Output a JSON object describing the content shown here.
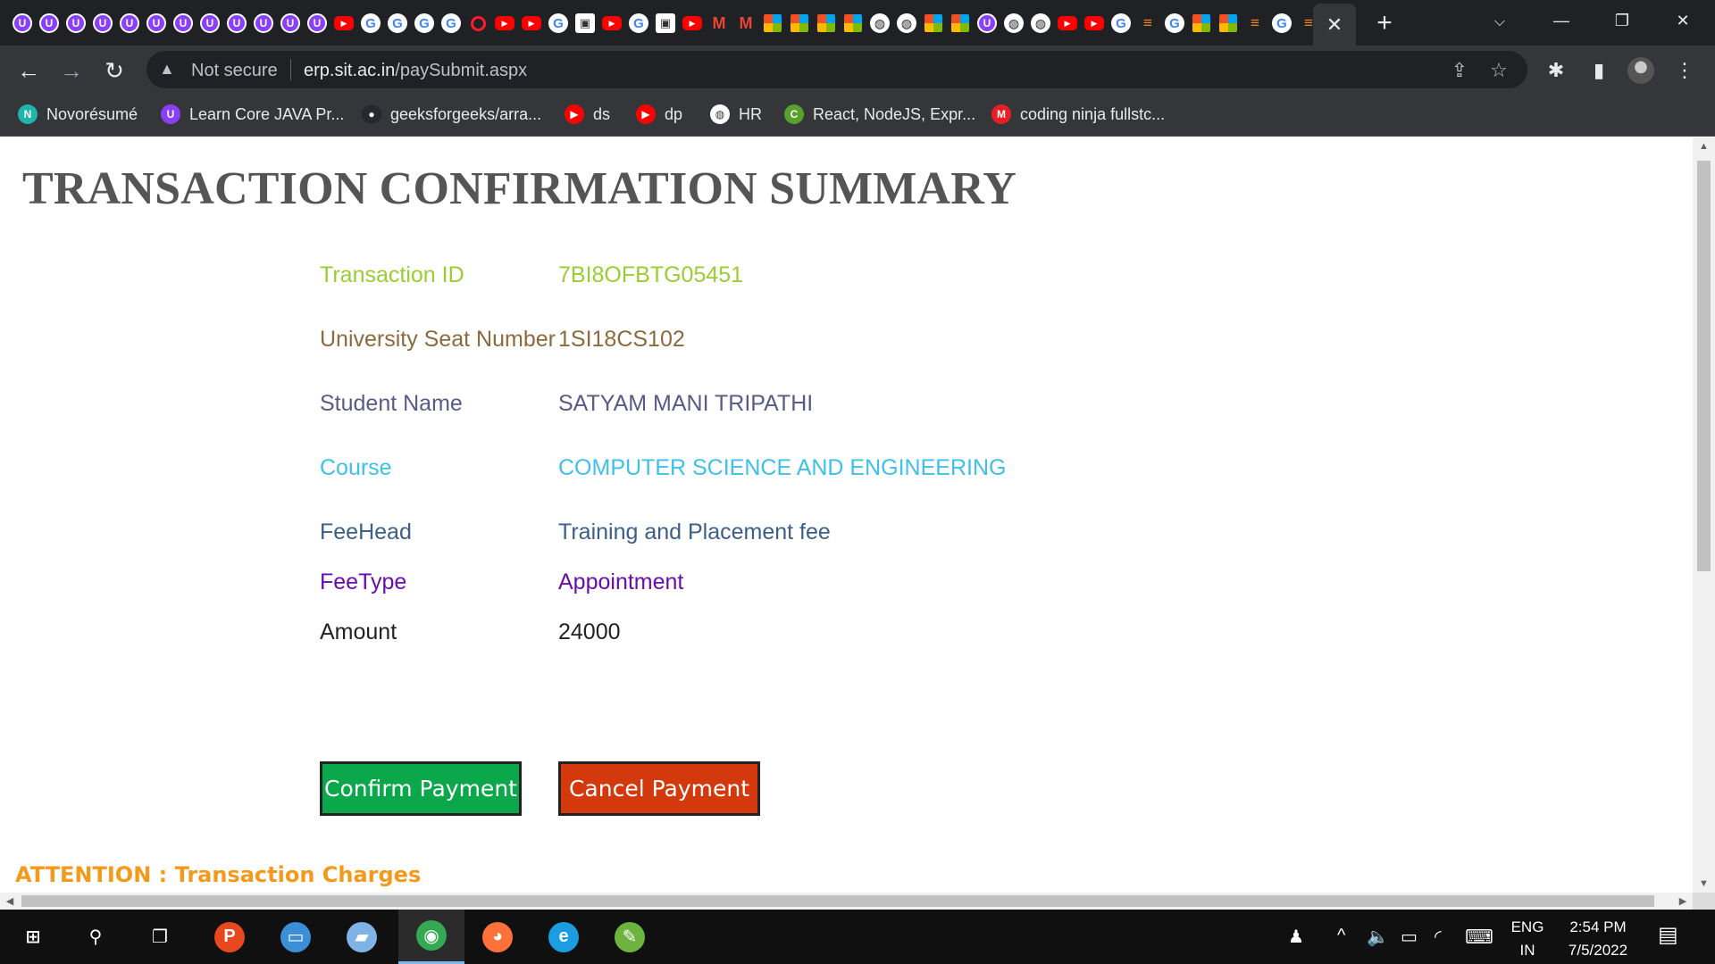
{
  "tabs": {
    "favicons": [
      "u",
      "u",
      "u",
      "u",
      "u",
      "u",
      "u",
      "u",
      "u",
      "u",
      "u",
      "u",
      "yt",
      "g",
      "g",
      "g",
      "g",
      "op",
      "yt",
      "yt",
      "g",
      "mz",
      "yt",
      "g",
      "mz",
      "yt",
      "gm",
      "gm",
      "ms",
      "ms",
      "ms",
      "ms",
      "gl",
      "gl",
      "ms",
      "ms",
      "u",
      "gl",
      "gl",
      "yt",
      "yt",
      "g",
      "so",
      "g",
      "ms",
      "ms",
      "so",
      "g",
      "so",
      "ms"
    ],
    "active_close": "✕",
    "new_tab": "+"
  },
  "address_bar": {
    "security_label": "Not secure",
    "url_host": "erp.sit.ac.in",
    "url_path": "/paySubmit.aspx"
  },
  "bookmarks": [
    {
      "label": "Novorésumé",
      "icon": "N",
      "color": "#1fb5ac"
    },
    {
      "label": "Learn Core JAVA Pr...",
      "icon": "U",
      "color": "#8a3ffc"
    },
    {
      "label": "geeksforgeeks/arra...",
      "icon": "●",
      "color": "#24292e"
    },
    {
      "label": "ds",
      "icon": "▶",
      "color": "#ff0000"
    },
    {
      "label": "dp",
      "icon": "▶",
      "color": "#ff0000"
    },
    {
      "label": "HR",
      "icon": "◍",
      "color": "#ffffff"
    },
    {
      "label": "React, NodeJS, Expr...",
      "icon": "C",
      "color": "#5aa02c"
    },
    {
      "label": "coding ninja fullstc...",
      "icon": "M",
      "color": "#ea1c24"
    }
  ],
  "page": {
    "title": "TRANSACTION CONFIRMATION SUMMARY",
    "rows": [
      {
        "label": "Transaction ID",
        "value": "7BI8OFBTG05451",
        "color": "#9acd32"
      },
      {
        "label": "University Seat Number",
        "value": "1SI18CS102",
        "color": "#8b6b3d"
      },
      {
        "label": "Student Name",
        "value": "SATYAM MANI TRIPATHI",
        "color": "#5a5a8a"
      },
      {
        "label": "Course",
        "value": "COMPUTER SCIENCE AND ENGINEERING",
        "color": "#3ec1e8"
      },
      {
        "label": "FeeHead",
        "value": "Training and Placement fee",
        "color": "#3b5f8a"
      },
      {
        "label": "FeeType",
        "value": "Appointment",
        "color": "#6a0dad"
      },
      {
        "label": "Amount",
        "value": "24000",
        "color": "#222222"
      }
    ],
    "confirm_label": "Confirm Payment",
    "cancel_label": "Cancel Payment",
    "attention": "ATTENTION  : Transaction Charges"
  },
  "taskbar": {
    "apps": [
      {
        "name": "start",
        "glyph": "⊞",
        "color": "transparent"
      },
      {
        "name": "search",
        "glyph": "⚲",
        "color": "transparent"
      },
      {
        "name": "task-view",
        "glyph": "❐",
        "color": "transparent"
      },
      {
        "name": "postman",
        "glyph": "P",
        "color": "#e8481d"
      },
      {
        "name": "explorer",
        "glyph": "▭",
        "color": "#3a8fd6"
      },
      {
        "name": "notepad",
        "glyph": "▰",
        "color": "#7fb2e5"
      },
      {
        "name": "chrome",
        "glyph": "◉",
        "color": "#34a853"
      },
      {
        "name": "firefox",
        "glyph": "◕",
        "color": "#ff7139"
      },
      {
        "name": "edge",
        "glyph": "e",
        "color": "#1b9de2"
      },
      {
        "name": "editor",
        "glyph": "✎",
        "color": "#6cb33f"
      }
    ],
    "lang_top": "ENG",
    "lang_bottom": "IN",
    "time": "2:54 PM",
    "date": "7/5/2022"
  }
}
